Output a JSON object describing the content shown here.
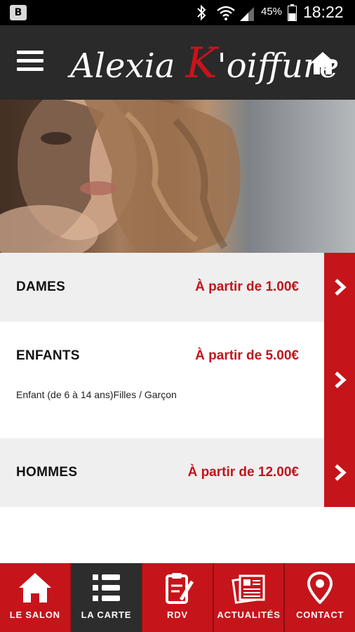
{
  "status_bar": {
    "battery": "45%",
    "time": "18:22"
  },
  "header": {
    "brand_part1": "Alexia ",
    "brand_k": "K",
    "brand_part2": "'oiffure"
  },
  "menu": [
    {
      "title": "DAMES",
      "price": "À partir de 1.00€",
      "desc": ""
    },
    {
      "title": "ENFANTS",
      "price": "À partir de 5.00€",
      "desc": "Enfant (de 6 à 14 ans)Filles / Garçon"
    },
    {
      "title": "HOMMES",
      "price": "À partir de 12.00€",
      "desc": ""
    }
  ],
  "nav": {
    "items": [
      {
        "label": "LE SALON",
        "icon": "home-icon"
      },
      {
        "label": "LA CARTE",
        "icon": "list-icon",
        "active": true
      },
      {
        "label": "RDV",
        "icon": "clipboard-icon"
      },
      {
        "label": "ACTUALITÉS",
        "icon": "newspaper-icon"
      },
      {
        "label": "CONTACT",
        "icon": "location-pin-icon"
      }
    ]
  },
  "colors": {
    "accent": "#c6141b",
    "header_bg": "#2a2a2a",
    "price": "#c0151c"
  }
}
